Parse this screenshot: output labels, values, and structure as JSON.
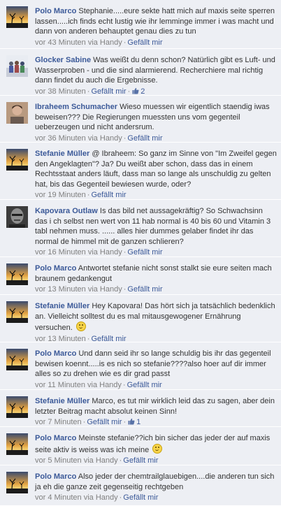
{
  "comments": [
    {
      "author": "Polo Marco",
      "avatar": "sunset-tree-avatar",
      "text": "Stephanie.....eure sekte hatt mich auf maxis seite sperren lassen.....ich finds echt lustig wie ihr lemminge immer i was macht und dann von anderen behauptet genau dies zu tun",
      "time": "vor 43 Minuten via Handy",
      "like": "Gefällt mir"
    },
    {
      "author": "Glocker Sabine",
      "avatar": "crowd-avatar",
      "text": "Was weißt du denn schon? Natürlich gibt es Luft- und Wasserproben - und die sind alarmierend. Recherchiere mal richtig dann findet du auch die Ergebnisse.",
      "time": "vor 38 Minuten",
      "like": "Gefällt mir",
      "like_count": "2"
    },
    {
      "author": "Ibraheem Schumacher",
      "avatar": "person-avatar",
      "text": "Wieso muessen wir eigentlich staendig iwas beweisen??? Die Regierungen muessten uns vom gegenteil ueberzeugen und nicht andersrum.",
      "time": "vor 36 Minuten via Handy",
      "like": "Gefällt mir"
    },
    {
      "author": "Stefanie Müller",
      "avatar": "sunset-tree-avatar",
      "text": "@ Ibraheem: So ganz im Sinne von \"Im Zweifel gegen den Angeklagten\"? Ja? Du weißt aber schon, dass das in einem Rechtsstaat anders läuft, dass man so lange als unschuldig zu gelten hat, bis das Gegenteil bewiesen wurde, oder?",
      "time": "vor 19 Minuten",
      "like": "Gefällt mir"
    },
    {
      "author": "Kapovara Outlaw",
      "avatar": "bw-face-avatar",
      "text": "Is das bild net aussagekräftig? So Schwachsinn das i ch selbst nen wert von 11 hab normal is 40 bis 60 und Vitamin 3 tabl nehmen muss. ...... alles hier dummes gelaber findet ihr das normal de himmel mit de ganzen schlieren?",
      "time": "vor 16 Minuten via Handy",
      "like": "Gefällt mir"
    },
    {
      "author": "Polo Marco",
      "avatar": "sunset-tree-avatar",
      "text": "Antwortet stefanie nicht sonst stalkt sie eure seiten mach braunem gedankengut",
      "time": "vor 13 Minuten via Handy",
      "like": "Gefällt mir"
    },
    {
      "author": "Stefanie Müller",
      "avatar": "sunset-tree-avatar",
      "text": "Hey Kapovara! Das hört sich ja tatsächlich bedenklich an. Vielleicht solltest du es mal mitausgewogener Ernährung versuchen.",
      "smiley": true,
      "time": "vor 13 Minuten",
      "like": "Gefällt mir"
    },
    {
      "author": "Polo Marco",
      "avatar": "sunset-tree-avatar",
      "text": "Und dann seid ihr so lange schuldig bis ihr das gegenteil bewisen koennt.....is es nich so stefanie????also hoer auf dir immer alles so zu drehen wie es dir grad passt",
      "time": "vor 11 Minuten via Handy",
      "like": "Gefällt mir"
    },
    {
      "author": "Stefanie Müller",
      "avatar": "sunset-tree-avatar",
      "text": "Marco, es tut mir wirklich leid das zu sagen, aber dein letzter Beitrag macht absolut keinen Sinn!",
      "time": "vor 7 Minuten",
      "like": "Gefällt mir",
      "like_count": "1"
    },
    {
      "author": "Polo Marco",
      "avatar": "sunset-tree-avatar",
      "text": "Meinste stefanie??ich bin sicher das jeder der auf maxis seite aktiv is weiss was ich meine",
      "smiley": true,
      "time": "vor 5 Minuten via Handy",
      "like": "Gefällt mir"
    },
    {
      "author": "Polo Marco",
      "avatar": "sunset-tree-avatar",
      "text": "Also jeder der chemtrailglauebigen....die anderen tun sich ja eh die ganze zeit gegenseitig rechtgeben",
      "time": "vor 4 Minuten via Handy",
      "like": "Gefällt mir"
    }
  ],
  "colors": {
    "background": "#edeff4",
    "author": "#3b5998",
    "text": "#333333",
    "meta": "#808080"
  }
}
